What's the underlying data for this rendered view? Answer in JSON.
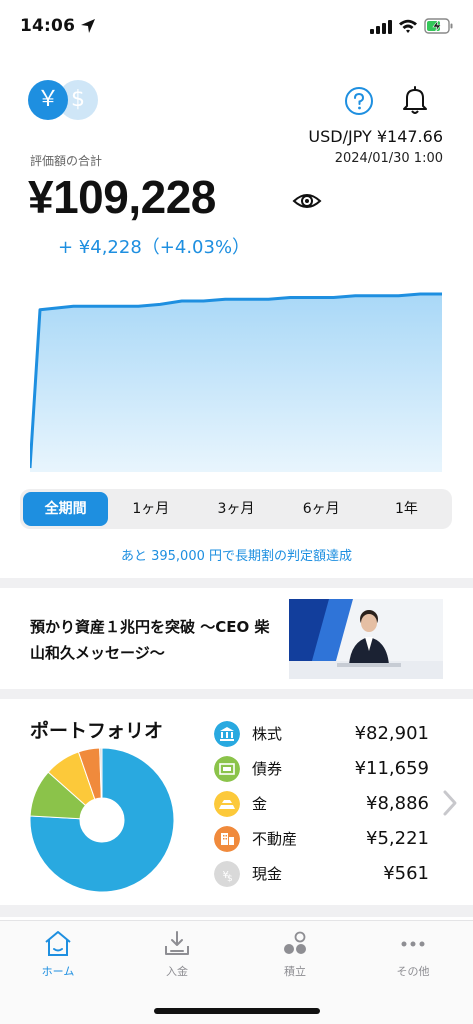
{
  "status": {
    "time": "14:06"
  },
  "header": {
    "yen_symbol": "￥",
    "usd_symbol": "$",
    "fx_rate": "USD/JPY  ¥147.66",
    "fx_time": "2024/01/30 1:00"
  },
  "summary": {
    "label": "評価額の合計",
    "total": "¥109,228",
    "gain": "+ ¥4,228（+4.03%）"
  },
  "colors": {
    "accent": "#1e8fe0",
    "chart_fill_top": "#a9d8f7",
    "chart_fill_bottom": "#e8f5fd",
    "stocks": "#29a9e0",
    "bonds": "#8bc34a",
    "gold": "#fcc93a",
    "real_estate": "#f08a3c",
    "cash": "#d9d9d9"
  },
  "performance_chart": {
    "series": [
      0.0,
      0.91,
      0.93,
      0.93,
      0.93,
      0.93,
      0.94,
      0.96,
      0.96,
      0.97,
      0.97,
      0.97,
      0.98,
      0.98,
      0.98,
      0.99,
      0.99,
      0.99,
      1.0,
      1.0
    ]
  },
  "period_tabs": [
    "全期間",
    "1ヶ月",
    "3ヶ月",
    "6ヶ月",
    "1年"
  ],
  "period_active": 0,
  "period_message": "あと 395,000 円で長期割の判定額達成",
  "news": {
    "title_line1": "預かり資産１兆円を突破 〜CEO 柴",
    "title_line2": "山和久メッセージ〜"
  },
  "portfolio": {
    "title": "ポートフォリオ",
    "assets": [
      {
        "name": "株式",
        "value": "¥82,901",
        "icon": "bank-icon",
        "amount": 82901
      },
      {
        "name": "債券",
        "value": "¥11,659",
        "icon": "bond-icon",
        "amount": 11659
      },
      {
        "name": "金",
        "value": "¥8,886",
        "icon": "gold-bar-icon",
        "amount": 8886
      },
      {
        "name": "不動産",
        "value": "¥5,221",
        "icon": "building-icon",
        "amount": 5221
      },
      {
        "name": "現金",
        "value": "¥561",
        "icon": "cash-icon",
        "amount": 561
      }
    ]
  },
  "tabbar": {
    "items": [
      {
        "label": "ホーム",
        "icon": "home-icon"
      },
      {
        "label": "入金",
        "icon": "deposit-icon"
      },
      {
        "label": "積立",
        "icon": "dots-icon"
      },
      {
        "label": "その他",
        "icon": "more-icon"
      }
    ]
  }
}
